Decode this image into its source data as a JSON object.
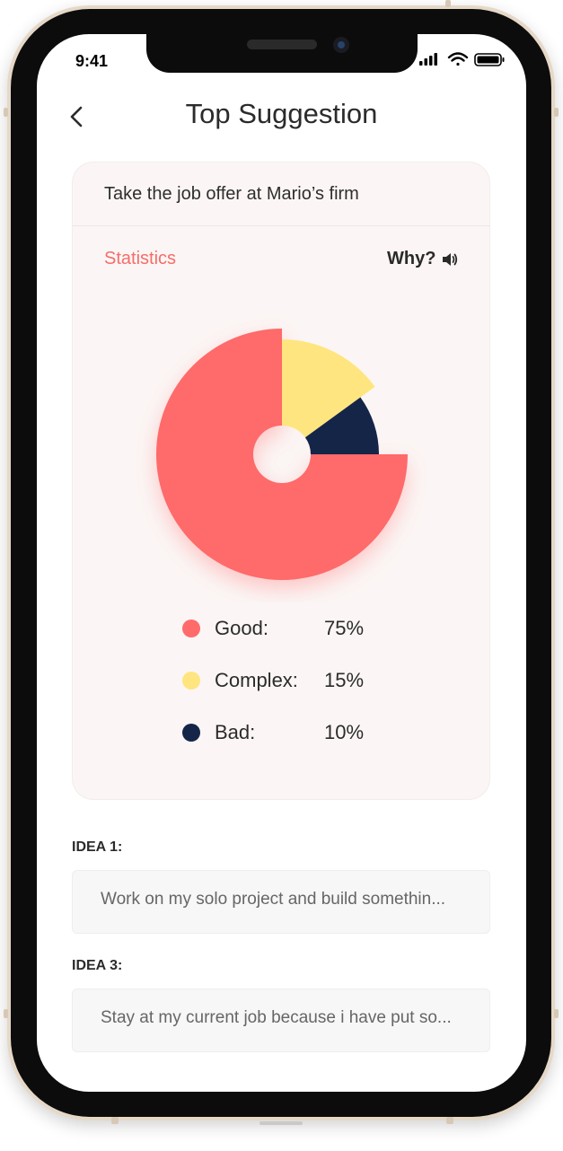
{
  "status_bar": {
    "time": "9:41"
  },
  "header": {
    "title": "Top Suggestion"
  },
  "suggestion_card": {
    "title": "Take the job offer at Mario’s firm",
    "statistics_label": "Statistics",
    "why_label": "Why?"
  },
  "chart_data": {
    "type": "pie",
    "categories": [
      "Good",
      "Complex",
      "Bad"
    ],
    "values": [
      75,
      15,
      10
    ],
    "colors": [
      "#ff6b6b",
      "#ffe57f",
      "#152548"
    ]
  },
  "legend": [
    {
      "label": "Good:",
      "value": "75%",
      "color": "#ff6b6b"
    },
    {
      "label": "Complex:",
      "value": "15%",
      "color": "#ffe57f"
    },
    {
      "label": "Bad:",
      "value": "10%",
      "color": "#152548"
    }
  ],
  "ideas": [
    {
      "label": "IDEA 1:",
      "text": "Work on my solo project and build somethin..."
    },
    {
      "label": "IDEA 3:",
      "text": "Stay at my current job because i have put so..."
    }
  ],
  "icons": {
    "back": "chevron-left-icon",
    "speaker": "speaker-icon"
  }
}
